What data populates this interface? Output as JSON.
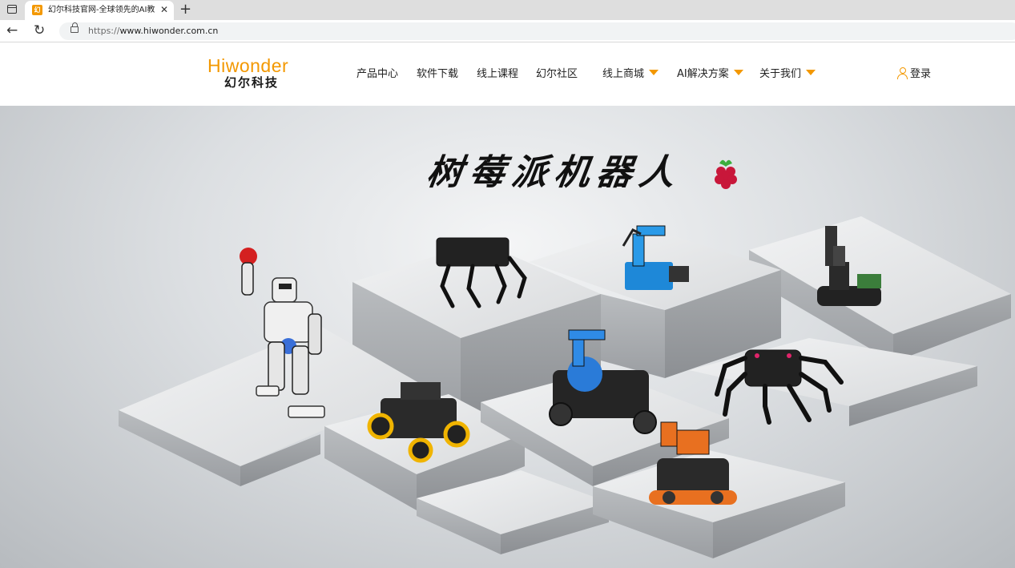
{
  "browser": {
    "tab_title": "幻尔科技官网-全球领先的AI教育",
    "tab_favicon_text": "幻",
    "url_scheme": "https://",
    "url_host": "www.hiwonder.com.cn",
    "icons": [
      "window-menu-icon",
      "close-icon",
      "plus-icon",
      "back-arrow-icon",
      "reload-icon",
      "lock-icon"
    ]
  },
  "header": {
    "logo_en": "Hiwonder",
    "logo_cn": "幻尔科技",
    "nav": [
      {
        "label": "产品中心",
        "dropdown": false
      },
      {
        "label": "软件下载",
        "dropdown": false
      },
      {
        "label": "线上课程",
        "dropdown": false
      },
      {
        "label": "幻尔社区",
        "dropdown": false
      },
      {
        "label": "线上商城",
        "dropdown": true
      },
      {
        "label": "AI解决方案",
        "dropdown": true
      },
      {
        "label": "关于我们",
        "dropdown": true
      }
    ],
    "login_label": "登录",
    "accent_color": "#f39800"
  },
  "hero": {
    "title": "树莓派机器人",
    "icon": "raspberry-icon"
  }
}
